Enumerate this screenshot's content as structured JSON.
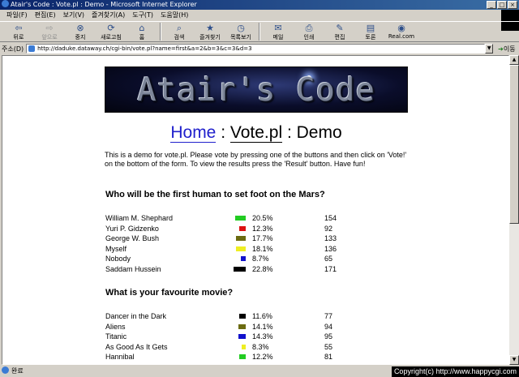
{
  "window": {
    "title": "Atair's Code : Vote.pl : Demo - Microsoft Internet Explorer",
    "buttons": [
      "_",
      "□",
      "×"
    ]
  },
  "menu": [
    "파일(F)",
    "편집(E)",
    "보기(V)",
    "즐겨찾기(A)",
    "도구(T)",
    "도움말(H)"
  ],
  "toolbar": [
    {
      "label": "뒤로",
      "icon": "back-arrow-icon",
      "disabled": false
    },
    {
      "label": "앞으로",
      "icon": "forward-arrow-icon",
      "disabled": true
    },
    {
      "label": "중지",
      "icon": "stop-icon",
      "disabled": false
    },
    {
      "label": "새로고침",
      "icon": "refresh-icon",
      "disabled": false
    },
    {
      "label": "홈",
      "icon": "home-icon",
      "disabled": false
    },
    {
      "label": "검색",
      "icon": "search-icon",
      "disabled": false
    },
    {
      "label": "즐겨찾기",
      "icon": "favorites-icon",
      "disabled": false
    },
    {
      "label": "목록보기",
      "icon": "history-icon",
      "disabled": false
    },
    {
      "label": "메일",
      "icon": "mail-icon",
      "disabled": false
    },
    {
      "label": "인쇄",
      "icon": "print-icon",
      "disabled": false
    },
    {
      "label": "편집",
      "icon": "edit-icon",
      "disabled": false
    },
    {
      "label": "토론",
      "icon": "discuss-icon",
      "disabled": false
    },
    {
      "label": "Real.com",
      "icon": "real-icon",
      "disabled": false
    }
  ],
  "address": {
    "label": "주소(D)",
    "url": "http://daduke.dataway.ch/cgi-bin/vote.pl?name=first&a=2&b=3&c=3&d=3",
    "go_label": "이동"
  },
  "page": {
    "banner_text": "Atair's Code",
    "title_home": "Home",
    "title_sep1": " : ",
    "title_vote": "Vote.pl",
    "title_sep2": " : Demo",
    "intro": "This is a demo for vote.pl. Please vote by pressing one of the buttons and then click on 'Vote!' on the bottom of the form. To view the results press the 'Result' button. Have fun!",
    "polls": [
      {
        "question": "Who will be the first human to set foot on the Mars?",
        "options": [
          {
            "name": "William M. Shephard",
            "color": "#22cc22",
            "percent": "20.5%",
            "votes": "154"
          },
          {
            "name": "Yuri P. Gidzenko",
            "color": "#dd1111",
            "percent": "12.3%",
            "votes": "92"
          },
          {
            "name": "George W. Bush",
            "color": "#6b6b10",
            "percent": "17.7%",
            "votes": "133"
          },
          {
            "name": "Myself",
            "color": "#eeee22",
            "percent": "18.1%",
            "votes": "136"
          },
          {
            "name": "Nobody",
            "color": "#1111cc",
            "percent": "8.7%",
            "votes": "65"
          },
          {
            "name": "Saddam Hussein",
            "color": "#000000",
            "percent": "22.8%",
            "votes": "171"
          }
        ]
      },
      {
        "question": "What is your favourite movie?",
        "options": [
          {
            "name": "Dancer in the Dark",
            "color": "#000000",
            "percent": "11.6%",
            "votes": "77"
          },
          {
            "name": "Aliens",
            "color": "#6b6b10",
            "percent": "14.1%",
            "votes": "94"
          },
          {
            "name": "Titanic",
            "color": "#1111cc",
            "percent": "14.3%",
            "votes": "95"
          },
          {
            "name": "As Good As It Gets",
            "color": "#eeee22",
            "percent": "8.3%",
            "votes": "55"
          },
          {
            "name": "Hannibal",
            "color": "#22cc22",
            "percent": "12.2%",
            "votes": "81"
          }
        ]
      }
    ]
  },
  "status": {
    "text": "완료",
    "copyright": "Copyright(c) http://www.happycgi.com"
  }
}
